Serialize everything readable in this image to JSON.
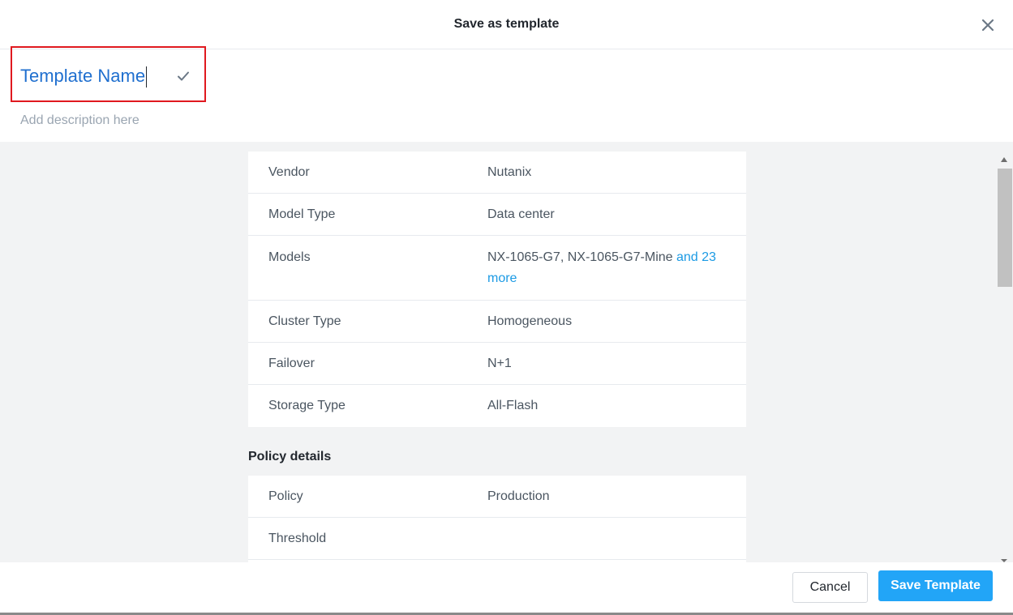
{
  "dialog": {
    "title": "Save as template",
    "close_icon": "close-icon"
  },
  "template": {
    "name_value": "Template Name",
    "confirm_icon": "check-icon",
    "description_placeholder": "Add description here"
  },
  "summary": {
    "rows": [
      {
        "label": "Vendor",
        "value": "Nutanix"
      },
      {
        "label": "Model Type",
        "value": "Data center"
      },
      {
        "label": "Models",
        "value": "NX-1065-G7, NX-1065-G7-Mine",
        "link": "and 23 more"
      },
      {
        "label": "Cluster Type",
        "value": "Homogeneous"
      },
      {
        "label": "Failover",
        "value": "N+1"
      },
      {
        "label": "Storage Type",
        "value": "All-Flash"
      }
    ]
  },
  "policy": {
    "section_title": "Policy details",
    "rows": [
      {
        "label": "Policy",
        "value": "Production"
      },
      {
        "label": "Threshold",
        "value": ""
      }
    ]
  },
  "footer": {
    "cancel_label": "Cancel",
    "save_label": "Save Template"
  },
  "colors": {
    "accent": "#22a5f7",
    "link": "#1b9ae4",
    "name_text": "#1f6fcf",
    "highlight_border": "#e0191f"
  }
}
